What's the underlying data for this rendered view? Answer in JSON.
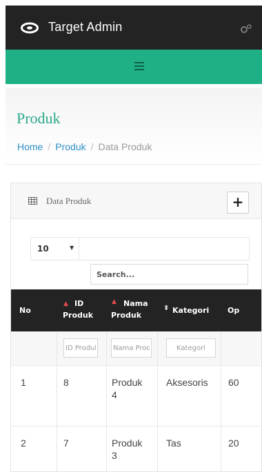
{
  "app": {
    "title": "Target Admin"
  },
  "icons": {
    "brand": "eye-logo-icon",
    "settings": "gears-icon",
    "menu": "hamburger-icon",
    "table": "table-grid-icon"
  },
  "colors": {
    "topbar": "#232323",
    "accent": "#1fb185",
    "title": "#2aa88a",
    "link": "#2f8fc8",
    "sort_active": "#e34d4d"
  },
  "page": {
    "title": "Produk"
  },
  "breadcrumb": [
    {
      "label": "Home"
    },
    {
      "label": "Produk"
    },
    {
      "label": "Data Produk"
    }
  ],
  "panel": {
    "title": "Data Produk",
    "add_label": "+"
  },
  "table_controls": {
    "page_length": "10",
    "search_placeholder": "Search..."
  },
  "table": {
    "columns": [
      {
        "label": "No"
      },
      {
        "label": "ID Produk",
        "line1": "ID",
        "line2": "Produk",
        "sort": "asc"
      },
      {
        "label": "Nama Produk",
        "line1": "Nama",
        "line2": "Produk",
        "sort": "asc"
      },
      {
        "label": "Kategori",
        "sort": "both"
      },
      {
        "label": "Op"
      }
    ],
    "filters": {
      "id": "ID Produk",
      "nama": "Nama Produk",
      "kategori": "Kategori"
    },
    "rows": [
      {
        "no": "1",
        "id": "8",
        "nama_line1": "Produk",
        "nama_line2": "4",
        "kategori": "Aksesoris",
        "op": "60"
      },
      {
        "no": "2",
        "id": "7",
        "nama_line1": "Produk",
        "nama_line2": "3",
        "kategori": "Tas",
        "op": "20"
      }
    ]
  }
}
